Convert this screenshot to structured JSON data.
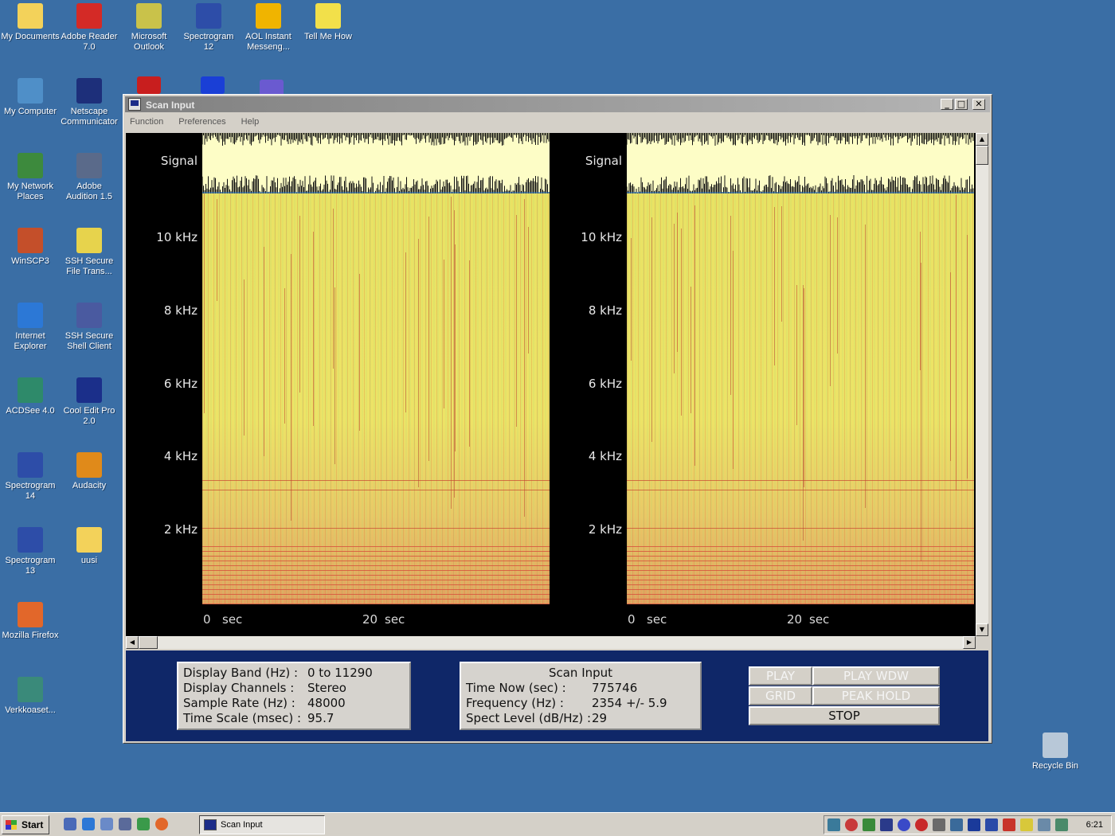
{
  "desktop_icons": [
    {
      "label": "My Documents",
      "icon": "folder-documents-icon",
      "color": "#f3d25a"
    },
    {
      "label": "Adobe Reader\n7.0",
      "icon": "adobe-reader-icon",
      "color": "#d42a26"
    },
    {
      "label": "Microsoft\nOutlook",
      "icon": "outlook-icon",
      "color": "#c9c24a"
    },
    {
      "label": "Spectrogram\n12",
      "icon": "spectrogram-icon",
      "color": "#2d4da8"
    },
    {
      "label": "AOL Instant\nMesseng...",
      "icon": "aim-icon",
      "color": "#f0b400"
    },
    {
      "label": "Tell Me How",
      "icon": "help-icon",
      "color": "#f2e04a"
    },
    {
      "label": "My Computer",
      "icon": "computer-icon",
      "color": "#4f8fc8"
    },
    {
      "label": "Netscape\nCommunicator",
      "icon": "netscape-icon",
      "color": "#1d2f7a"
    },
    {
      "label": "My Network\nPlaces",
      "icon": "network-icon",
      "color": "#3d8a3d"
    },
    {
      "label": "Adobe\nAudition 1.5",
      "icon": "audition-icon",
      "color": "#5a6a8a"
    },
    {
      "label": "WinSCP3",
      "icon": "winscp-icon",
      "color": "#c44f2a"
    },
    {
      "label": "SSH Secure\nFile Trans...",
      "icon": "ssh-file-icon",
      "color": "#e7d34c"
    },
    {
      "label": "Internet\nExplorer",
      "icon": "ie-icon",
      "color": "#2c78d6"
    },
    {
      "label": "SSH Secure\nShell Client",
      "icon": "ssh-shell-icon",
      "color": "#4a5aa0"
    },
    {
      "label": "ACDSee 4.0",
      "icon": "acdsee-icon",
      "color": "#2e8a6a"
    },
    {
      "label": "Cool Edit Pro\n2.0",
      "icon": "cool-edit-icon",
      "color": "#1b2f8a"
    },
    {
      "label": "Spectrogram\n14",
      "icon": "spectrogram-icon",
      "color": "#2d4da8"
    },
    {
      "label": "Audacity",
      "icon": "audacity-icon",
      "color": "#e08a1a"
    },
    {
      "label": "Spectrogram\n13",
      "icon": "spectrogram-icon",
      "color": "#2d4da8"
    },
    {
      "label": "uusi",
      "icon": "folder-icon",
      "color": "#f3d25a"
    },
    {
      "label": "Mozilla Firefox",
      "icon": "firefox-icon",
      "color": "#e2672a"
    },
    {
      "label": "Verkkoaset...",
      "icon": "bmp-icon",
      "color": "#3a8a7a"
    },
    {
      "label": "Recycle Bin",
      "icon": "recycle-bin-icon",
      "color": "#b8c8d8"
    }
  ],
  "window": {
    "title": "Scan Input",
    "menu": [
      "Function",
      "Preferences",
      "Help"
    ]
  },
  "spectrogram": {
    "signal_label": "Signal",
    "y_labels": [
      "10 kHz",
      "8 kHz",
      "6 kHz",
      "4 kHz",
      "2 kHz"
    ],
    "x_labels": [
      {
        "value": "0",
        "unit": "sec"
      },
      {
        "value": "20",
        "unit": "sec"
      }
    ]
  },
  "info": {
    "left": [
      {
        "key": "Display Band (Hz) :",
        "value": "0 to 11290"
      },
      {
        "key": "Display Channels :",
        "value": "Stereo"
      },
      {
        "key": "Sample Rate (Hz) :",
        "value": "48000"
      },
      {
        "key": "Time Scale (msec) :",
        "value": "95.7"
      }
    ],
    "middle_title": "Scan Input",
    "middle": [
      {
        "key": "Time Now (sec) :",
        "value": "775746"
      },
      {
        "key": "Frequency (Hz) :",
        "value": "2354 +/- 5.9"
      },
      {
        "key": "Spect Level (dB/Hz) :",
        "value": "29"
      }
    ]
  },
  "controls": {
    "play": "PLAY",
    "play_wdw": "PLAY WDW",
    "grid": "GRID",
    "peak_hold": "PEAK HOLD",
    "stop": "STOP"
  },
  "taskbar": {
    "start": "Start",
    "task": "Scan Input",
    "clock": "6:21"
  }
}
